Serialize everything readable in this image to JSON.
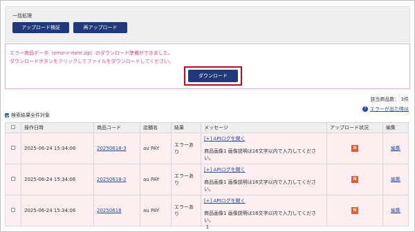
{
  "bulk": {
    "title": "一括処理",
    "verify_label": "アップロード検証",
    "reupload_label": "再アップロード"
  },
  "notice": {
    "line1": "エラー商品データ（error-ir-item.zip）のダウンロード準備ができました。",
    "line2": "ダウンロードボタンをクリックしてファイルをダウンロードしてください。",
    "download_label": "ダウンロード"
  },
  "result_count": "該当商品数： 3件",
  "help_link": "エラーが出た時は",
  "select_all_label": "検索結果全件対象",
  "table": {
    "headers": [
      "操作日時",
      "商品コード",
      "店舗名",
      "結果",
      "メッセージ",
      "アップロード状況",
      "編集"
    ],
    "rows": [
      {
        "datetime": "2025-06-24 15:34:06",
        "code": "20250618-3",
        "store": "au PAY",
        "result": "エラーあり",
        "log_link": "[+] APIログを開く",
        "message": "商品画像1 画像説明は16文字以内で入力してください。",
        "status": "N",
        "edit": "編集"
      },
      {
        "datetime": "2025-06-24 15:34:06",
        "code": "20250618-2",
        "store": "au PAY",
        "result": "エラーあり",
        "log_link": "[+] APIログを開く",
        "message": "商品画像1 画像説明は16文字以内で入力してください。",
        "status": "N",
        "edit": "編集"
      },
      {
        "datetime": "2025-06-24 15:34:06",
        "code": "20250618",
        "store": "au PAY",
        "result": "エラーあり",
        "log_link": "[+] APIログを開く",
        "message": "商品画像1 画像説明は16文字以内で入力してください。",
        "status": "N",
        "edit": "編集"
      }
    ]
  },
  "pager": {
    "current": "1"
  },
  "colors": {
    "navy": "#21397a",
    "notice_pink": "#e03b8a",
    "row_pink": "#fdeff2",
    "badge_orange": "#f0582e",
    "highlight_red": "#d0021b"
  }
}
